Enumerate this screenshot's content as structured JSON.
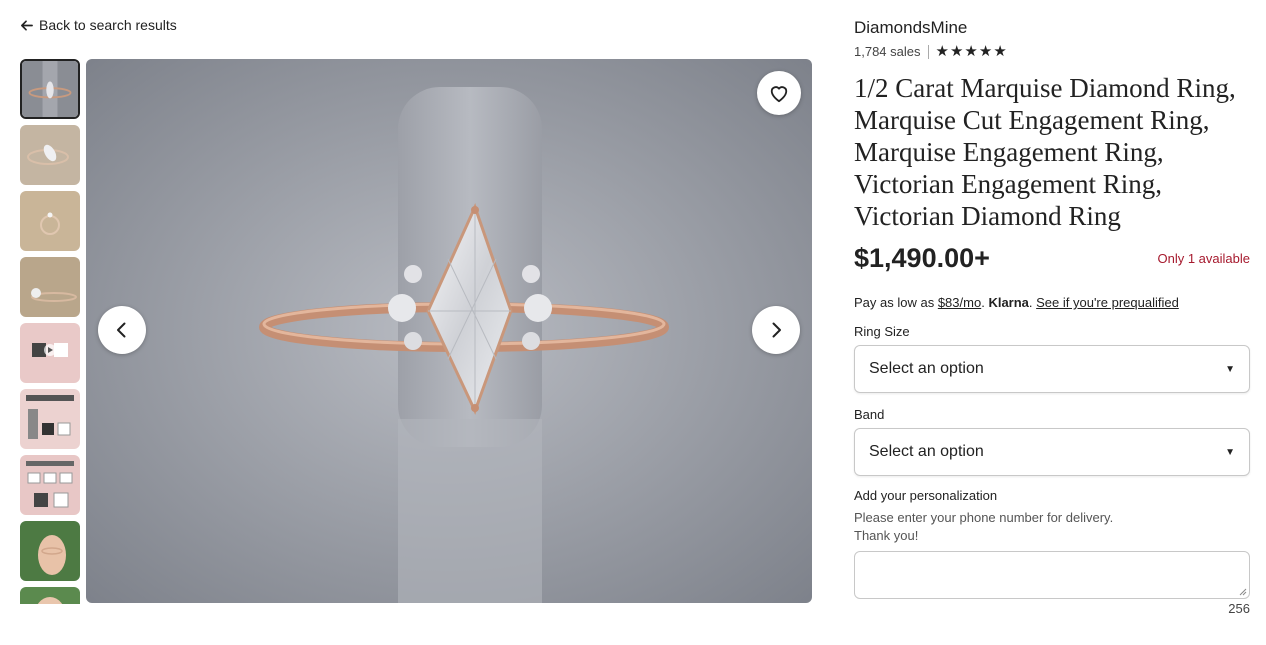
{
  "nav": {
    "back_label": "Back to search results"
  },
  "gallery": {
    "thumbnails": [
      {
        "name": "ring-top-view"
      },
      {
        "name": "ring-angle-view"
      },
      {
        "name": "ring-side-flat"
      },
      {
        "name": "ring-side-view"
      },
      {
        "name": "video-thumbnail"
      },
      {
        "name": "size-guide-graphic"
      },
      {
        "name": "packaging-graphic"
      },
      {
        "name": "ring-on-hand"
      },
      {
        "name": "ring-on-hand-2"
      }
    ]
  },
  "shop": {
    "name": "DiamondsMine",
    "sales": "1,784 sales",
    "rating_stars": 5
  },
  "listing": {
    "title": "1/2 Carat Marquise Diamond Ring, Marquise Cut Engagement Ring, Marquise Engagement Ring, Victorian Engagement Ring, Victorian Diamond Ring",
    "price": "$1,490.00+",
    "stock": "Only 1 available"
  },
  "financing": {
    "prefix": "Pay as low as ",
    "amount": "$83/mo",
    "sep1": ". ",
    "provider": "Klarna",
    "sep2": ". ",
    "link": "See if you're prequalified"
  },
  "options": {
    "ring_size_label": "Ring Size",
    "ring_size_value": "Select an option",
    "band_label": "Band",
    "band_value": "Select an option"
  },
  "personalization": {
    "label": "Add your personalization",
    "help_line1": "Please enter your phone number for delivery.",
    "help_line2": "Thank you!",
    "value": "",
    "counter": "256"
  },
  "colors": {
    "stock": "#a61a2e",
    "text": "#222222"
  }
}
